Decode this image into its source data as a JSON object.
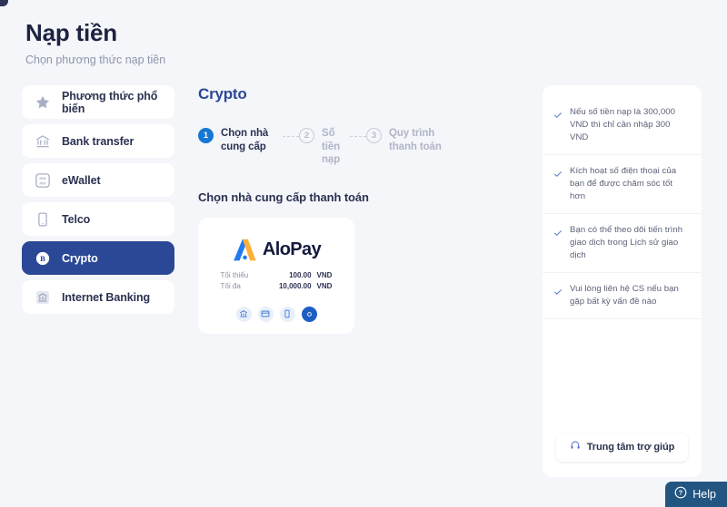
{
  "header": {
    "title": "Nạp tiền",
    "subtitle": "Chọn phương thức nạp tiền"
  },
  "sidebar": {
    "items": [
      {
        "label": "Phương thức phổ biến",
        "icon": "star-icon",
        "active": false
      },
      {
        "label": "Bank transfer",
        "icon": "bank-icon",
        "active": false
      },
      {
        "label": "eWallet",
        "icon": "momo-wallet-icon",
        "active": false
      },
      {
        "label": "Telco",
        "icon": "mobile-phone-icon",
        "active": false
      },
      {
        "label": "Crypto",
        "icon": "bitcoin-coin-icon",
        "active": true
      },
      {
        "label": "Internet Banking",
        "icon": "internet-banking-icon",
        "active": false
      }
    ]
  },
  "main": {
    "title": "Crypto",
    "stepper": [
      {
        "num": "1",
        "label": "Chọn nhà cung cấp",
        "state": "active"
      },
      {
        "num": "2",
        "label": "Số tiền nạp",
        "state": "inactive"
      },
      {
        "num": "3",
        "label": "Quy trình thanh toán",
        "state": "inactive"
      }
    ],
    "section_title": "Chọn nhà cung cấp thanh toán",
    "provider": {
      "name": "AloPay",
      "min_label": "Tối thiểu",
      "min_value": "100.00",
      "min_currency": "VND",
      "max_label": "Tối đa",
      "max_value": "10,000.00",
      "max_currency": "VND",
      "pay_icons": [
        "bank-icon",
        "card-icon",
        "mobile-phone-icon",
        "crypto-coin-icon"
      ]
    }
  },
  "info_panel": {
    "items": [
      "Nếu số tiền nạp là 300,000 VND thì chỉ cần nhập 300 VND",
      "Kích hoạt số điện thoại của bạn để được chăm sóc tốt hơn",
      "Bạn có thể theo dõi tiến trình giao dịch trong Lịch sử giao dịch",
      "Vui lòng liên hệ CS nếu bạn gặp bất kỳ vấn đề nào"
    ],
    "help_center_label": "Trung tâm trợ giúp"
  },
  "floating": {
    "help_label": "Help"
  },
  "colors": {
    "accent_navy": "#2b4896",
    "step_blue": "#1577d2",
    "page_bg": "#f4f6fa",
    "card_bg": "#ffffff",
    "logo_orange": "#fbb03b",
    "logo_blue": "#1f7bf0",
    "fab_blue": "#225681"
  }
}
